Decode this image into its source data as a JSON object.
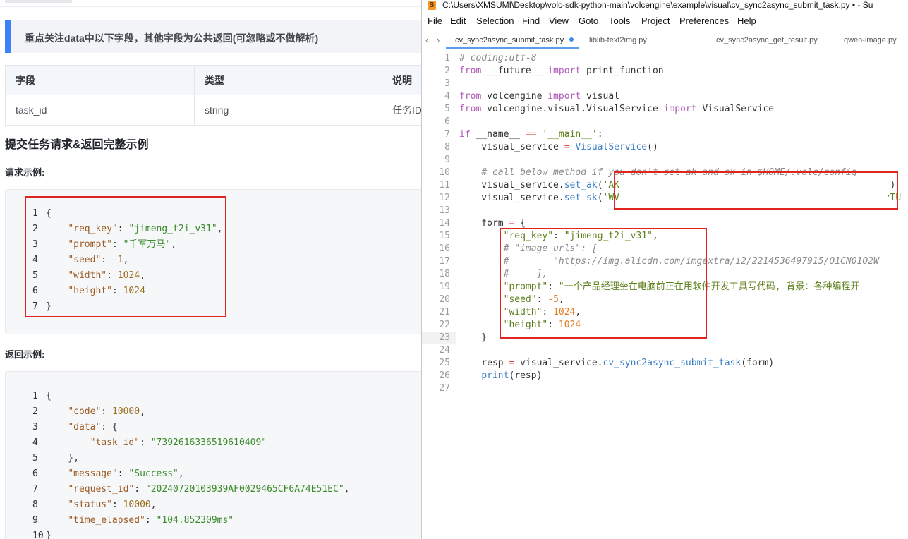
{
  "doc": {
    "notice": "重点关注data中以下字段，其他字段为公共返回(可忽略或不做解析)",
    "table": {
      "headers": [
        "字段",
        "类型",
        "说明"
      ],
      "row": [
        "task_id",
        "string",
        "任务ID"
      ]
    },
    "section_title": "提交任务请求&返回完整示例",
    "request_label": "请求示例:",
    "response_label": "返回示例:"
  },
  "editor": {
    "window_title": "C:\\Users\\XMSUMI\\Desktop\\volc-sdk-python-main\\volcengine\\example\\visual\\cv_sync2async_submit_task.py • - Su",
    "menu": [
      "File",
      "Edit",
      "Selection",
      "Find",
      "View",
      "Goto",
      "Tools",
      "Project",
      "Preferences",
      "Help"
    ],
    "tabs": [
      "cv_sync2async_submit_task.py",
      "liblib-text2img.py",
      "cv_sync2async_get_result.py",
      "qwen-image.py"
    ],
    "active_tab": 0,
    "current_line": 23
  },
  "colors": {
    "accent": "#3a82f6",
    "highlight_box": "#e0241f",
    "modified_dot": "#3b8de8"
  }
}
